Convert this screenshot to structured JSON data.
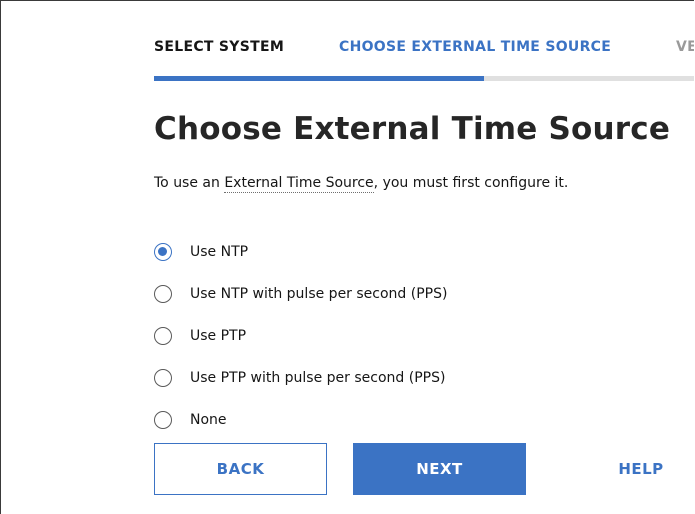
{
  "wizard": {
    "steps": [
      {
        "label": "SELECT SYSTEM",
        "state": "complete"
      },
      {
        "label": "CHOOSE EXTERNAL TIME SOURCE",
        "state": "active"
      },
      {
        "label": "VE",
        "state": "upcoming"
      }
    ],
    "progress_fraction": 0.59
  },
  "page": {
    "title": "Choose External Time Source",
    "intro_prefix": "To use an ",
    "intro_link": "External Time Source",
    "intro_suffix": ", you must first configure it."
  },
  "options": [
    {
      "label": "Use NTP",
      "selected": true
    },
    {
      "label": "Use NTP with pulse per second (PPS)",
      "selected": false
    },
    {
      "label": "Use PTP",
      "selected": false
    },
    {
      "label": "Use PTP with pulse per second (PPS)",
      "selected": false
    },
    {
      "label": "None",
      "selected": false
    }
  ],
  "actions": {
    "back_label": "BACK",
    "next_label": "NEXT",
    "help_label": "HELP"
  },
  "colors": {
    "accent": "#3b73c4",
    "track": "#e0e0e0",
    "text": "#161616",
    "muted": "#9a9a9a"
  }
}
